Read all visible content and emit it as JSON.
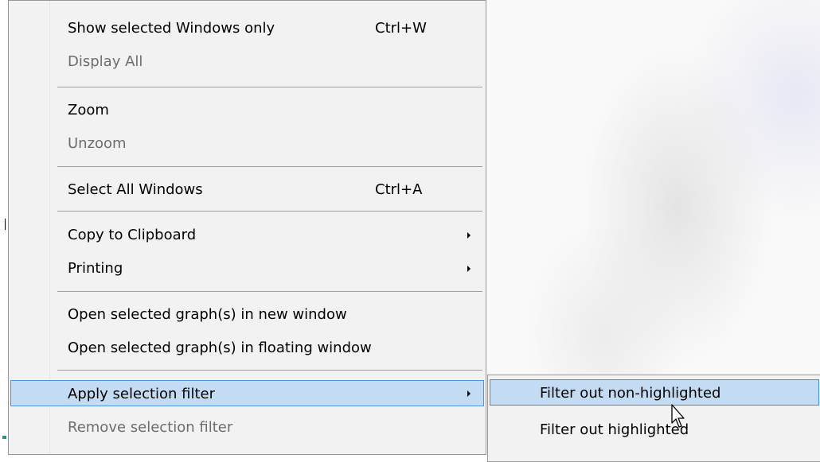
{
  "menu": {
    "items": [
      {
        "label": "Show selected Windows only",
        "shortcut": "Ctrl+W",
        "disabled": false
      },
      {
        "label": "Display All",
        "disabled": true
      },
      {
        "label": "Zoom",
        "disabled": false
      },
      {
        "label": "Unzoom",
        "disabled": true
      },
      {
        "label": "Select All Windows",
        "shortcut": "Ctrl+A",
        "disabled": false
      },
      {
        "label": "Copy to Clipboard",
        "submenu": true,
        "disabled": false
      },
      {
        "label": "Printing",
        "submenu": true,
        "disabled": false
      },
      {
        "label": "Open selected graph(s) in new window",
        "disabled": false
      },
      {
        "label": "Open selected graph(s) in floating window",
        "disabled": false
      },
      {
        "label": "Apply selection filter",
        "submenu": true,
        "selected": true,
        "disabled": false
      },
      {
        "label": "Remove selection filter",
        "disabled": true
      }
    ]
  },
  "submenu": {
    "items": [
      {
        "label": "Filter out non-highlighted",
        "selected": true
      },
      {
        "label": "Filter out highlighted"
      }
    ]
  },
  "colors": {
    "menu_background": "#f2f2f2",
    "highlight_background": "#c3dcf3",
    "highlight_border": "#4d95d8",
    "disabled_text": "#6d6d6d"
  },
  "cursor_icon": "arrow-pointer-icon"
}
